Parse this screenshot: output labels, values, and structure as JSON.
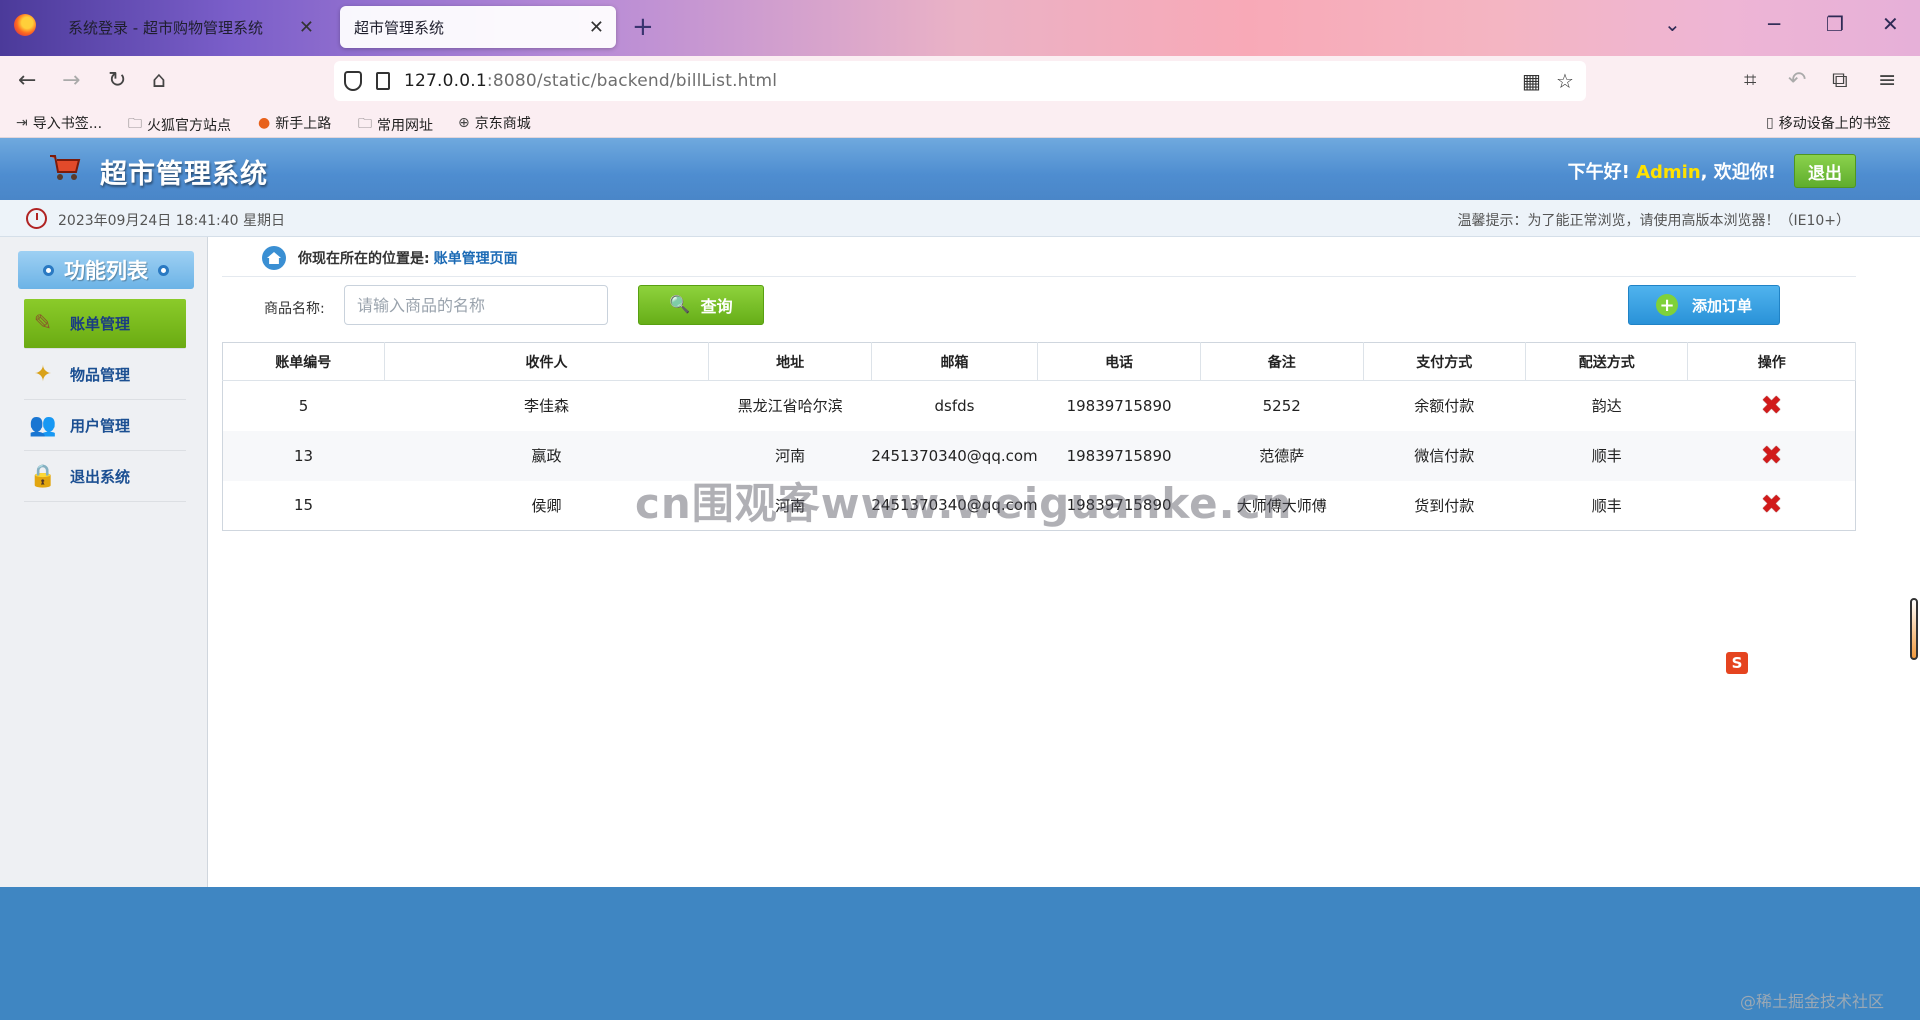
{
  "browser": {
    "tabs": [
      {
        "title": "系统登录 - 超市购物管理系统"
      },
      {
        "title": "超市管理系统"
      }
    ],
    "url": {
      "host": "127.0.0.1",
      "rest": ":8080/static/backend/billList.html"
    },
    "bookmarks": [
      {
        "label": "导入书签..."
      },
      {
        "label": "火狐官方站点"
      },
      {
        "label": "新手上路"
      },
      {
        "label": "常用网址"
      },
      {
        "label": "京东商城"
      },
      {
        "label": "移动设备上的书签"
      }
    ]
  },
  "header": {
    "title": "超市管理系统",
    "greeting_prefix": "下午好!",
    "user": "Admin",
    "greeting_suffix": ", 欢迎你!",
    "logout_label": "退出"
  },
  "infobar": {
    "datetime": "2023年09月24日 18:41:40 星期日",
    "tip": "温馨提示：为了能正常浏览，请使用高版本浏览器！（IE10+）"
  },
  "sidebar": {
    "title": "功能列表",
    "items": [
      {
        "label": "账单管理",
        "icon": "bill-icon"
      },
      {
        "label": "物品管理",
        "icon": "goods-icon"
      },
      {
        "label": "用户管理",
        "icon": "users-icon"
      },
      {
        "label": "退出系统",
        "icon": "exit-icon"
      }
    ]
  },
  "breadcrumb": {
    "label": "你现在所在的位置是:",
    "current": "账单管理页面"
  },
  "search": {
    "label": "商品名称:",
    "placeholder": "请输入商品的名称",
    "query_label": "查询",
    "add_label": "添加订单"
  },
  "table": {
    "columns": [
      "账单编号",
      "收件人",
      "地址",
      "邮箱",
      "电话",
      "备注",
      "支付方式",
      "配送方式",
      "操作"
    ],
    "rows": [
      [
        "5",
        "李佳森",
        "黑龙江省哈尔滨",
        "dsfds",
        "19839715890",
        "5252",
        "余额付款",
        "韵达"
      ],
      [
        "13",
        "嬴政",
        "河南",
        "2451370340@qq.com",
        "19839715890",
        "范德萨",
        "微信付款",
        "顺丰"
      ],
      [
        "15",
        "侯卿",
        "河南",
        "2451370340@qq.com",
        "19839715890",
        "大师傅大师傅",
        "货到付款",
        "顺丰"
      ]
    ]
  },
  "watermark": "cn围观客www.weiguanke.cn",
  "credit": "@稀土掘金技术社区",
  "colors": {
    "header_blue": "#4e8dd0",
    "accent_green": "#6aab12",
    "add_blue": "#2a92d8",
    "footer_blue": "#3f86c2"
  }
}
